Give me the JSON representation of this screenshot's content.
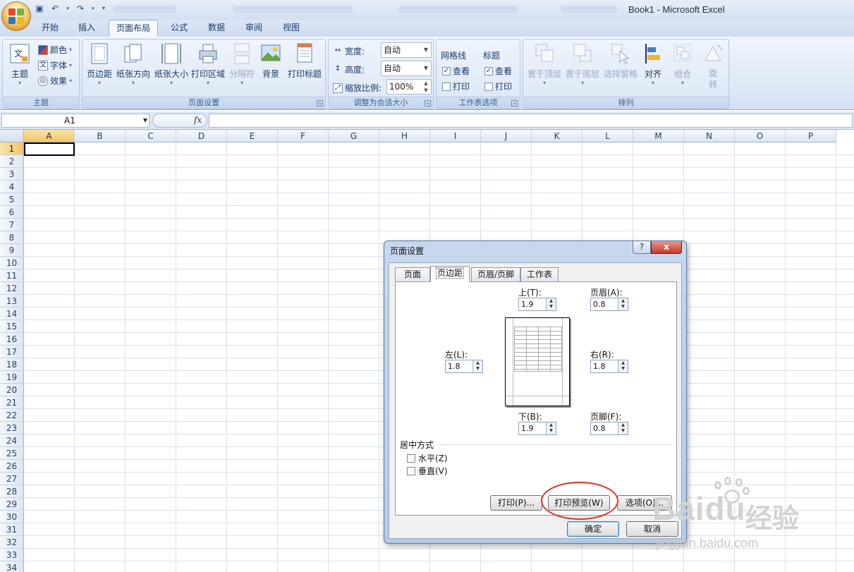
{
  "window": {
    "title": "Book1 - Microsoft Excel"
  },
  "ribbon_tabs": [
    "开始",
    "插入",
    "页面布局",
    "公式",
    "数据",
    "审阅",
    "视图"
  ],
  "active_tab": "页面布局",
  "groups": {
    "theme": {
      "label": "主题",
      "big": "主题",
      "colors": "颜色",
      "fonts": "字体",
      "effects": "效果"
    },
    "page_setup": {
      "label": "页面设置",
      "buttons": [
        "页边距",
        "纸张方向",
        "纸张大小",
        "打印区域",
        "分隔符",
        "背景",
        "打印标题"
      ]
    },
    "scale": {
      "label": "调整为合适大小",
      "width_label": "宽度:",
      "width_value": "自动",
      "height_label": "高度:",
      "height_value": "自动",
      "scale_label": "缩放比例:",
      "scale_value": "100%"
    },
    "sheet_options": {
      "label": "工作表选项",
      "gridlines": "网格线",
      "headings": "标题",
      "view": "查看",
      "print": "打印"
    },
    "arrange": {
      "label": "排列",
      "buttons": [
        "置于顶层",
        "置于底层",
        "选择窗格",
        "对齐",
        "组合",
        "旋转"
      ]
    }
  },
  "formula_bar": {
    "name_box": "A1",
    "fx": "fx",
    "value": ""
  },
  "columns": [
    "A",
    "B",
    "C",
    "D",
    "E",
    "F",
    "G",
    "H",
    "I",
    "J",
    "K",
    "L",
    "M",
    "N",
    "O",
    "P"
  ],
  "rows": [
    "1",
    "2",
    "3",
    "4",
    "5",
    "6",
    "7",
    "8",
    "9",
    "10",
    "11",
    "12",
    "13",
    "14",
    "15",
    "16",
    "17",
    "18",
    "19",
    "20",
    "21",
    "22",
    "23",
    "24",
    "25",
    "26",
    "27",
    "28",
    "29",
    "30",
    "31",
    "32",
    "33",
    "34"
  ],
  "dialog": {
    "title": "页面设置",
    "help": "?",
    "close": "x",
    "tabs": [
      "页面",
      "页边距",
      "页眉/页脚",
      "工作表"
    ],
    "active_tab": "页边距",
    "top_label": "上(T):",
    "top": "1.9",
    "header_label": "页眉(A):",
    "header": "0.8",
    "left_label": "左(L):",
    "left": "1.8",
    "right_label": "右(R):",
    "right": "1.8",
    "bottom_label": "下(B):",
    "bottom": "1.9",
    "footer_label": "页脚(F):",
    "footer": "0.8",
    "center_title": "居中方式",
    "horizontal": "水平(Z)",
    "vertical": "垂直(V)",
    "print_btn": "打印(P)...",
    "preview_btn": "打印预览(W)",
    "options_btn": "选项(O)...",
    "ok_btn": "确定",
    "cancel_btn": "取消"
  },
  "watermark": {
    "brand": "Baidu",
    "cn": "经验",
    "url": "jingyan.baidu.com"
  },
  "colors": {
    "ribbon_bg": "#dde8f6",
    "accent": "#e0312a",
    "select": "#f3c56a"
  }
}
